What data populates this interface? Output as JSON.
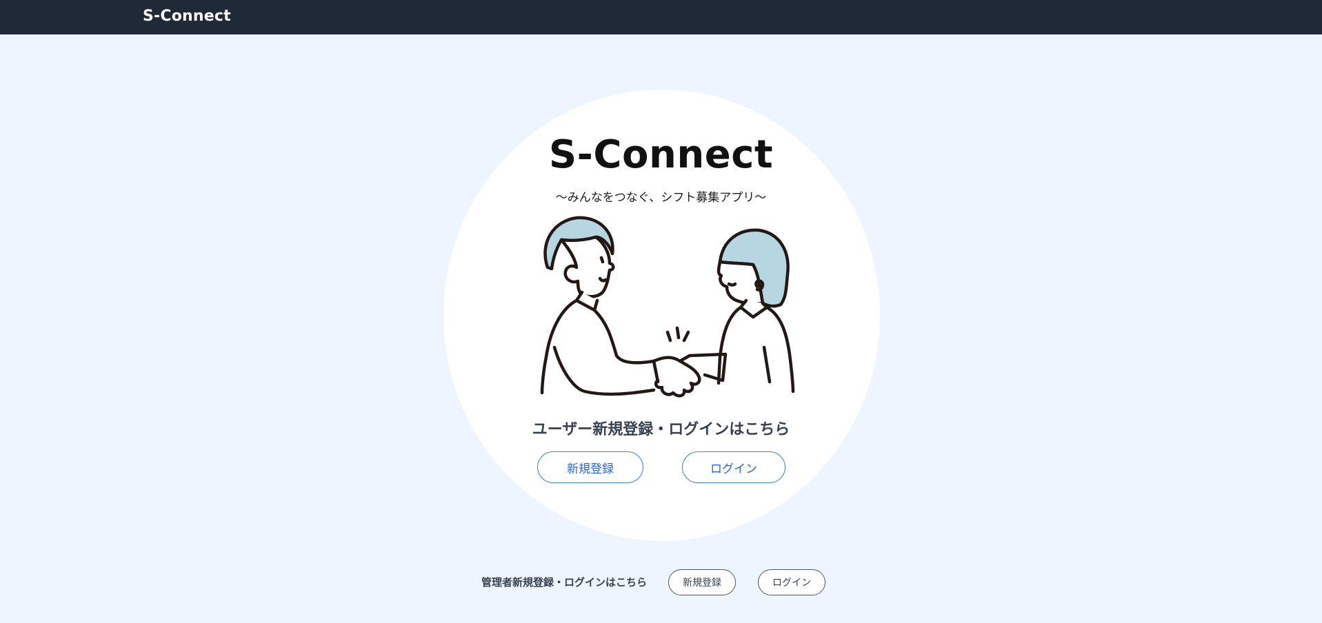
{
  "header": {
    "brand": "S-Connect"
  },
  "hero": {
    "title": "S-Connect",
    "subtitle": "〜みんなをつなぐ、シフト募集アプリ〜",
    "illustration_icon": "handshake-illustration"
  },
  "user_section": {
    "heading": "ユーザー新規登録・ログインはこちら",
    "register_label": "新規登録",
    "login_label": "ログイン"
  },
  "admin_section": {
    "label": "管理者新規登録・ログインはこちら",
    "register_label": "新規登録",
    "login_label": "ログイン"
  },
  "colors": {
    "header_bg": "#1f2937",
    "page_bg": "#eef5ff",
    "accent": "#3b82f6",
    "hair": "#b6d6e2"
  }
}
